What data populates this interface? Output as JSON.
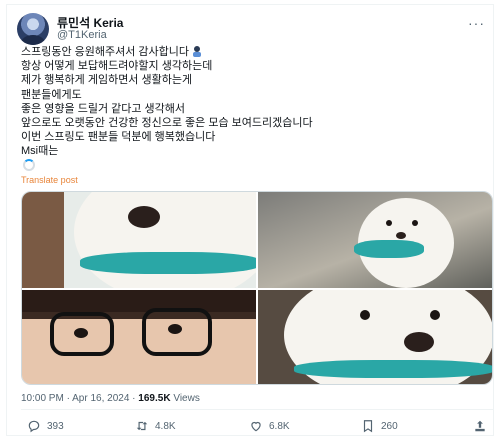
{
  "author": {
    "display_name": "류민석 Keria",
    "handle": "@T1Keria"
  },
  "post": {
    "lines": [
      "스프링동안 응원해주셔서 감사합니다",
      "항상 어떻게 보답해드려야할지 생각하는데",
      "제가 행복하게 게임하면서 생활하는게",
      "팬분들에게도",
      "좋은 영향을 드릴거 같다고 생각해서",
      "앞으로도 오랫동안 건강한 정신으로 좋은 모습 보여드리겠습니다",
      "이번 스프링도 팬분들 덕분에 행복했습니다",
      "Msi때는"
    ],
    "translate_label": "Translate post",
    "timestamp": "10:00 PM · Apr 16, 2024",
    "separator": " · ",
    "views_count": "169.5K",
    "views_label": " Views"
  },
  "actions": {
    "replies": "393",
    "reposts": "4.8K",
    "likes": "6.8K",
    "bookmarks": "260"
  },
  "icons": [
    "more-icon",
    "emoji-icon",
    "loading-icon",
    "reply-icon",
    "repost-icon",
    "like-icon",
    "bookmark-icon",
    "share-icon"
  ],
  "colors": {
    "translate_link": "#e8853a",
    "secondary_text": "#536471",
    "primary_text": "#0f1419",
    "collar": "#2aa7a6"
  }
}
